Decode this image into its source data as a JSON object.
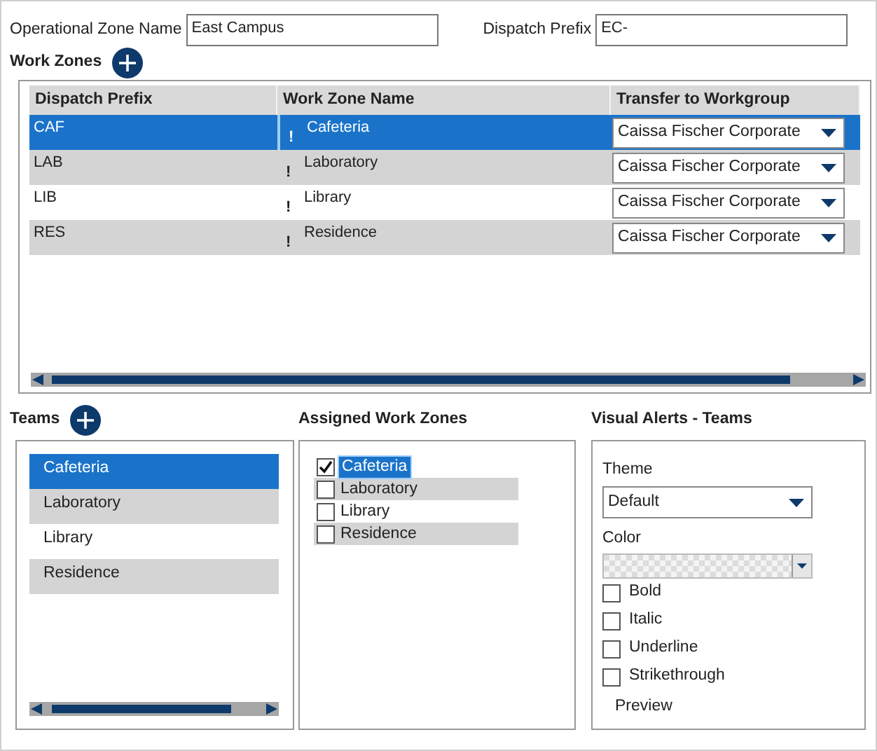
{
  "zone_name": {
    "label": "Operational Zone Name",
    "value": "East Campus"
  },
  "dispatch_prefix": {
    "label": "Dispatch Prefix",
    "value": "EC-"
  },
  "work_zones": {
    "title": "Work Zones",
    "columns": [
      "Dispatch Prefix",
      "Work Zone Name",
      "Transfer to Workgroup"
    ],
    "rows": [
      {
        "prefix": "CAF",
        "marker": "!",
        "name": "Cafeteria",
        "workgroup": "Caissa Fischer Corporate",
        "selected": true
      },
      {
        "prefix": "LAB",
        "marker": "!",
        "name": "Laboratory",
        "workgroup": "Caissa Fischer Corporate",
        "selected": false
      },
      {
        "prefix": "LIB",
        "marker": "!",
        "name": "Library",
        "workgroup": "Caissa Fischer Corporate",
        "selected": false
      },
      {
        "prefix": "RES",
        "marker": "!",
        "name": "Residence",
        "workgroup": "Caissa Fischer Corporate",
        "selected": false
      }
    ]
  },
  "teams": {
    "title": "Teams",
    "items": [
      {
        "label": "Cafeteria",
        "selected": true
      },
      {
        "label": "Laboratory",
        "selected": false
      },
      {
        "label": "Library",
        "selected": false
      },
      {
        "label": "Residence",
        "selected": false
      }
    ]
  },
  "assigned": {
    "title": "Assigned Work Zones",
    "items": [
      {
        "label": "Cafeteria",
        "checked": true,
        "selected": true
      },
      {
        "label": "Laboratory",
        "checked": false,
        "selected": false
      },
      {
        "label": "Library",
        "checked": false,
        "selected": false
      },
      {
        "label": "Residence",
        "checked": false,
        "selected": false
      }
    ]
  },
  "visual_alerts": {
    "title": "Visual Alerts - Teams",
    "theme_label": "Theme",
    "theme_value": "Default",
    "color_label": "Color",
    "options": [
      {
        "label": "Bold",
        "checked": false
      },
      {
        "label": "Italic",
        "checked": false
      },
      {
        "label": "Underline",
        "checked": false
      },
      {
        "label": "Strikethrough",
        "checked": false
      }
    ],
    "preview": "Preview"
  }
}
